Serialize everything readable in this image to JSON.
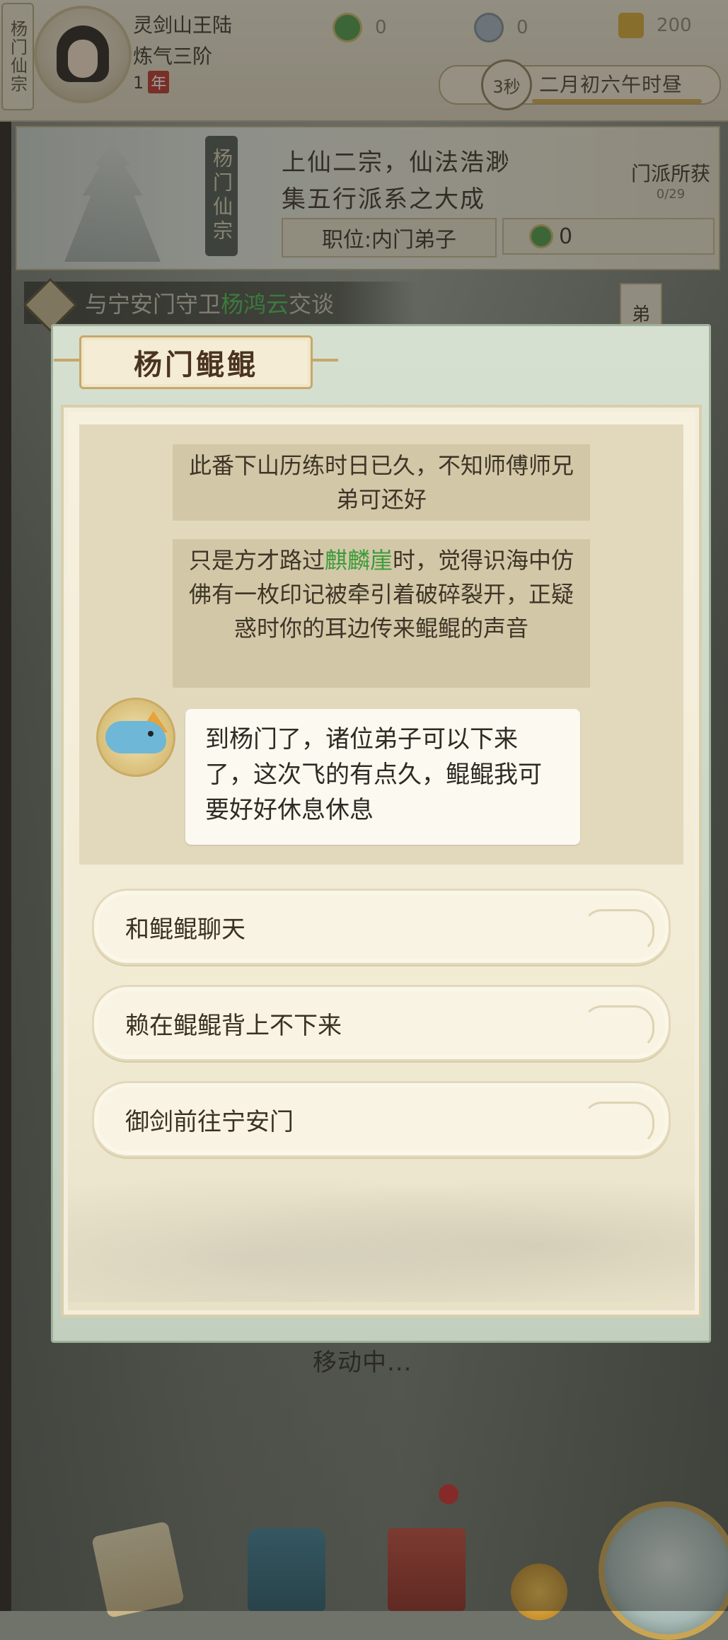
{
  "topbar": {
    "sect_tag": "杨门仙宗",
    "player_name": "灵剑山王陆",
    "player_rank": "炼气三阶",
    "player_age_value": "1",
    "player_age_unit": "年",
    "resources": [
      {
        "icon": "jade-coin-icon",
        "value": "0",
        "color": "#4d9a4a"
      },
      {
        "icon": "spirit-stone-icon",
        "value": "0",
        "color": "#a7b3bf"
      },
      {
        "icon": "gold-ingot-icon",
        "value": "200",
        "color": "#d8a834"
      }
    ],
    "time_seconds": "3秒",
    "time_text": "二月初六午时昼"
  },
  "sect": {
    "scroll_label": "杨门仙宗",
    "desc_line1": "上仙二宗，仙法浩渺",
    "desc_line2": "集五行派系之大成",
    "position_label": "职位:内门弟子",
    "contribution": "0",
    "gain_label": "门派所获",
    "gain_count": "0/29"
  },
  "task": {
    "prefix": "与宁安门守卫",
    "npc": "杨鸿云",
    "suffix": "交谈",
    "side_tab": "弟"
  },
  "status": {
    "moving": "移动中..."
  },
  "dialog": {
    "title": "杨门鲲鲲",
    "story": [
      {
        "text": "此番下山历练时日已久，不知师傅师兄弟可还好"
      },
      {
        "pre": "只是方才路过",
        "hl": "麒麟崖",
        "post": "时，觉得识海中仿佛有一枚印记被牵引着破碎裂开，正疑惑时你的耳边传来鲲鲲的声音"
      }
    ],
    "npc_speech": "到杨门了，诸位弟子可以下来了，这次飞的有点久，鲲鲲我可要好好休息休息",
    "options": [
      "和鲲鲲聊天",
      "赖在鲲鲲背上不下来",
      "御剑前往宁安门"
    ]
  },
  "colors": {
    "highlight_green": "#3c9a3a",
    "title_brown": "#4a3421",
    "paper": "#f3eedb"
  }
}
